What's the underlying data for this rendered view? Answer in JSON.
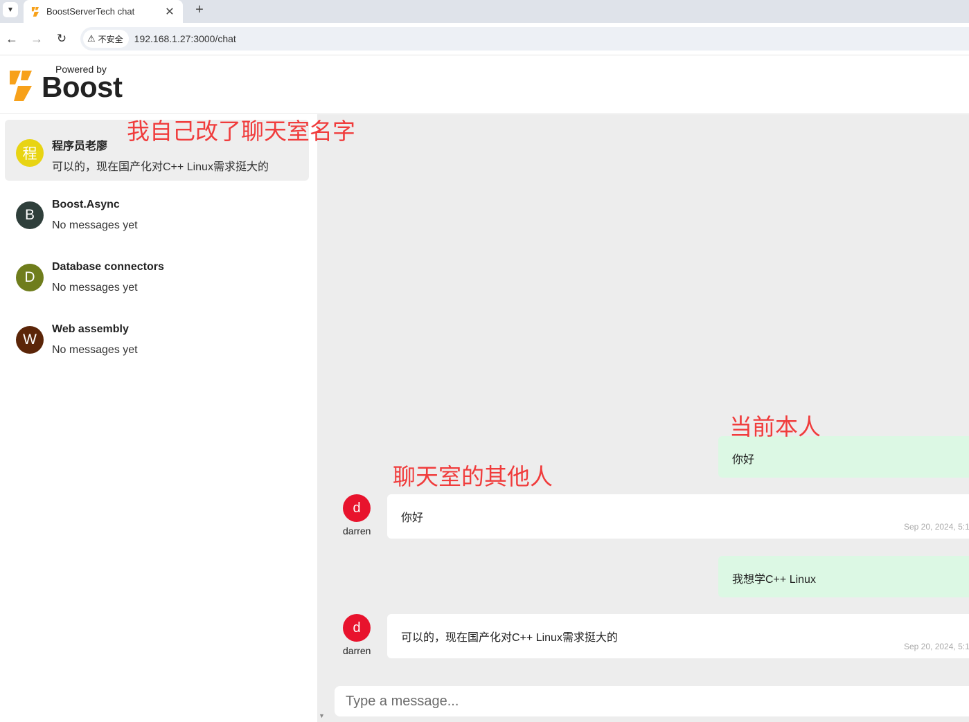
{
  "browser": {
    "tab_title": "BoostServerTech chat",
    "security_label": "不安全",
    "url": "192.168.1.27:3000/chat"
  },
  "header": {
    "powered_by": "Powered by",
    "brand": "Boost"
  },
  "rooms": [
    {
      "initial": "程",
      "name": "程序员老廖",
      "last_message": "可以的，现在国产化对C++ Linux需求挺大的",
      "color": "#e8d413",
      "active": true
    },
    {
      "initial": "B",
      "name": "Boost.Async",
      "last_message": "No messages yet",
      "color": "#2f3f3b",
      "active": false
    },
    {
      "initial": "D",
      "name": "Database connectors",
      "last_message": "No messages yet",
      "color": "#6f7d1c",
      "active": false
    },
    {
      "initial": "W",
      "name": "Web assembly",
      "last_message": "No messages yet",
      "color": "#5b2508",
      "active": false
    }
  ],
  "messages": [
    {
      "direction": "out",
      "text": "你好"
    },
    {
      "direction": "in",
      "avatar": "d",
      "username": "darren",
      "text": "你好",
      "timestamp": "Sep 20, 2024, 5:1"
    },
    {
      "direction": "out",
      "text": "我想学C++ Linux"
    },
    {
      "direction": "in",
      "avatar": "d",
      "username": "darren",
      "text": "可以的，现在国产化对C++ Linux需求挺大的",
      "timestamp": "Sep 20, 2024, 5:1"
    }
  ],
  "composer": {
    "placeholder": "Type a message..."
  },
  "annotations": {
    "rename": "我自己改了聊天室名字",
    "self": "当前本人",
    "others": "聊天室的其他人"
  },
  "colors": {
    "sender_avatar": "#e8132d",
    "outgoing_bubble": "#dcf8e4",
    "annotation": "#f03c3c",
    "brand_orange": "#f7a11a"
  }
}
